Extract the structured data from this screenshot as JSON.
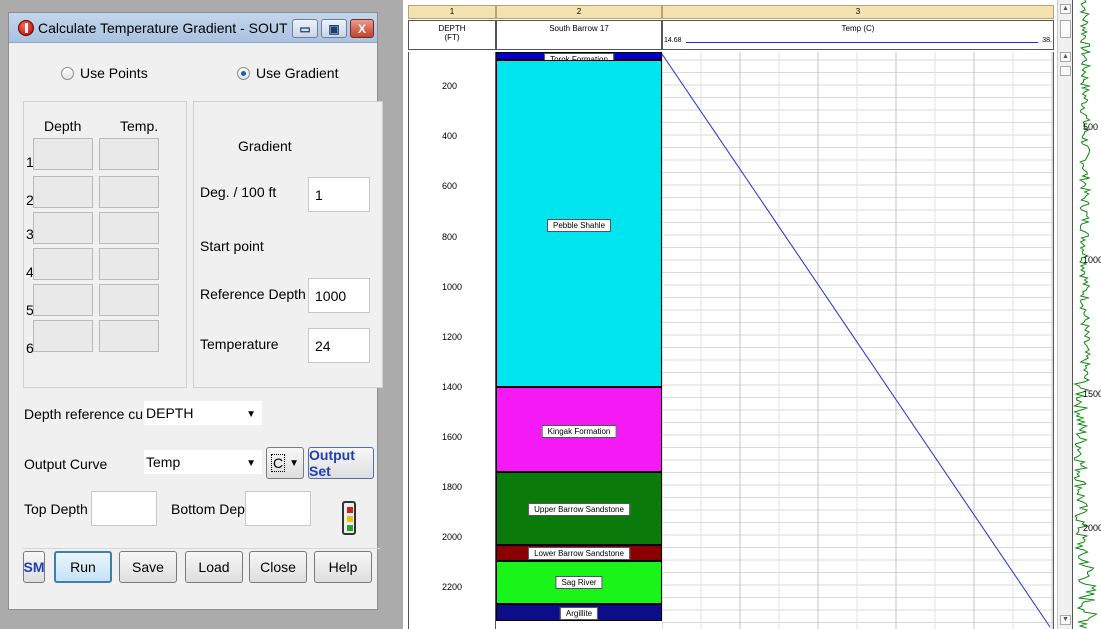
{
  "dialog": {
    "title": "Calculate Temperature Gradient - SOUTH BARRO...",
    "window_buttons": {
      "minimize": "▭",
      "maximize": "▣",
      "close": "X"
    },
    "mode": {
      "use_points": "Use Points",
      "use_gradient": "Use Gradient",
      "selected": "use_gradient"
    },
    "points": {
      "depth_header": "Depth",
      "temp_header": "Temp.",
      "rows": [
        "1",
        "2",
        "3",
        "4",
        "5",
        "6"
      ]
    },
    "gradient": {
      "header": "Gradient",
      "deg_label": "Deg. / 100 ft",
      "deg_value": "1",
      "start_point_label": "Start point",
      "ref_depth_label": "Reference Depth",
      "ref_depth_value": "1000",
      "temperature_label": "Temperature",
      "temperature_value": "24"
    },
    "depth_reference_curve_label": "Depth reference curve",
    "depth_reference_curve_value": "DEPTH",
    "output_curve_label": "Output Curve",
    "output_curve_value": "Temp",
    "unit_value": "C",
    "output_set_label": "Output Set",
    "top_depth_label": "Top Depth",
    "top_depth_value": "",
    "bottom_depth_label": "Bottom Depth",
    "bottom_depth_value": "",
    "buttons": {
      "sm": "SM",
      "run": "Run",
      "save": "Save",
      "load": "Load",
      "close": "Close",
      "help": "Help"
    }
  },
  "log": {
    "tracks": [
      {
        "number": "1",
        "title": "DEPTH",
        "subtitle": "(FT)"
      },
      {
        "number": "2",
        "title": "South Barrow 17",
        "subtitle": ""
      },
      {
        "number": "3",
        "title": "Temp (C)",
        "subtitle": ""
      }
    ],
    "temp_scale": {
      "left": "14.68",
      "right": "38."
    },
    "depth_labels": [
      "200",
      "400",
      "600",
      "800",
      "1000",
      "1200",
      "1400",
      "1600",
      "1800",
      "2000",
      "2200"
    ],
    "formations": [
      {
        "name": "Torok Formation",
        "color": "#0000cc"
      },
      {
        "name": "Pebble Shahle",
        "color": "#00e5ef"
      },
      {
        "name": "Kingak Formation",
        "color": "#f51af5"
      },
      {
        "name": "Upper Barrow Sandstone",
        "color": "#0a7a0a"
      },
      {
        "name": "Lower Barrow Sandstone",
        "color": "#8a0000"
      },
      {
        "name": "Sag River",
        "color": "#19f519"
      },
      {
        "name": "Argillite",
        "color": "#0d0d8a"
      }
    ],
    "strip_labels": [
      "500",
      "1000",
      "1500",
      "2000"
    ],
    "curve_color": "#1b2fd6",
    "strip_curve_color": "#0b8a0b"
  }
}
